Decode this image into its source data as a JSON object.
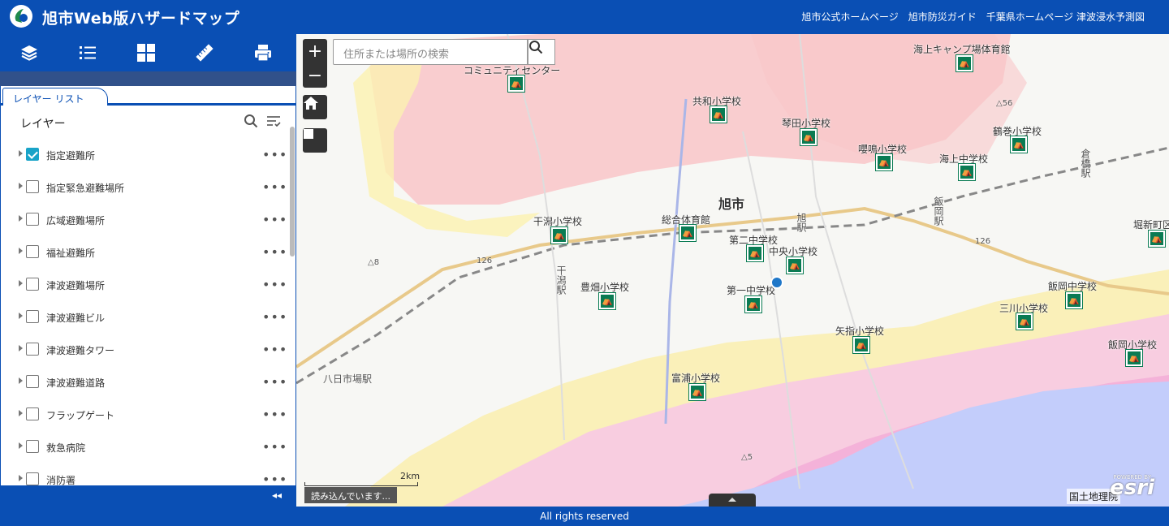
{
  "header": {
    "title": "旭市Web版ハザードマップ",
    "links": [
      "旭市公式ホームページ",
      "旭市防災ガイド",
      "千葉県ホームページ 津波浸水予測図"
    ]
  },
  "panel": {
    "tab_label": "レイヤー リスト",
    "heading": "レイヤー",
    "layers": [
      {
        "name": "指定避難所",
        "checked": true
      },
      {
        "name": "指定緊急避難場所",
        "checked": false
      },
      {
        "name": "広域避難場所",
        "checked": false
      },
      {
        "name": "福祉避難所",
        "checked": false
      },
      {
        "name": "津波避難場所",
        "checked": false
      },
      {
        "name": "津波避難ビル",
        "checked": false
      },
      {
        "name": "津波避難タワー",
        "checked": false
      },
      {
        "name": "津波避難道路",
        "checked": false
      },
      {
        "name": "フラップゲート",
        "checked": false
      },
      {
        "name": "救急病院",
        "checked": false
      },
      {
        "name": "消防署",
        "checked": false
      }
    ],
    "more_glyph": "•••",
    "collapse_glyph": "◂◂"
  },
  "map": {
    "search_placeholder": "住所または場所の検索",
    "zoom_in": "+",
    "zoom_out": "−",
    "loading_text": "読み込んでいます...",
    "scale_label": "2km",
    "attribution": "国土地理院",
    "esri_powered": "POWERED BY",
    "esri_logo": "esri",
    "city_label": "旭市",
    "pois": [
      {
        "label": "海上キャンプ場体育館"
      },
      {
        "label": "コミュニティセンター"
      },
      {
        "label": "共和小学校"
      },
      {
        "label": "琴田小学校"
      },
      {
        "label": "嚶鳴小学校"
      },
      {
        "label": "海上中学校"
      },
      {
        "label": "鶴巻小学校"
      },
      {
        "label": "干潟小学校"
      },
      {
        "label": "総合体育館"
      },
      {
        "label": "第二中学校"
      },
      {
        "label": "中央小学校"
      },
      {
        "label": "第一中学校"
      },
      {
        "label": "豊畑小学校"
      },
      {
        "label": "矢指小学校"
      },
      {
        "label": "三川小学校"
      },
      {
        "label": "飯岡中学校"
      },
      {
        "label": "飯岡小学校"
      },
      {
        "label": "富浦小学校"
      },
      {
        "label": "堀新町区"
      }
    ],
    "stations": [
      {
        "label": "八日市場駅"
      },
      {
        "label": "干潟駅"
      },
      {
        "label": "旭駅"
      },
      {
        "label": "飯岡駅"
      },
      {
        "label": "倉橋駅"
      }
    ],
    "elevations": [
      "△56",
      "△8",
      "△5"
    ],
    "route_labels": [
      "126",
      "126"
    ]
  },
  "footer": {
    "text": "All rights reserved"
  },
  "colors": {
    "brand": "#0a4fb4",
    "shelter": "#0a7b53",
    "sea": "#c3cdfb"
  }
}
